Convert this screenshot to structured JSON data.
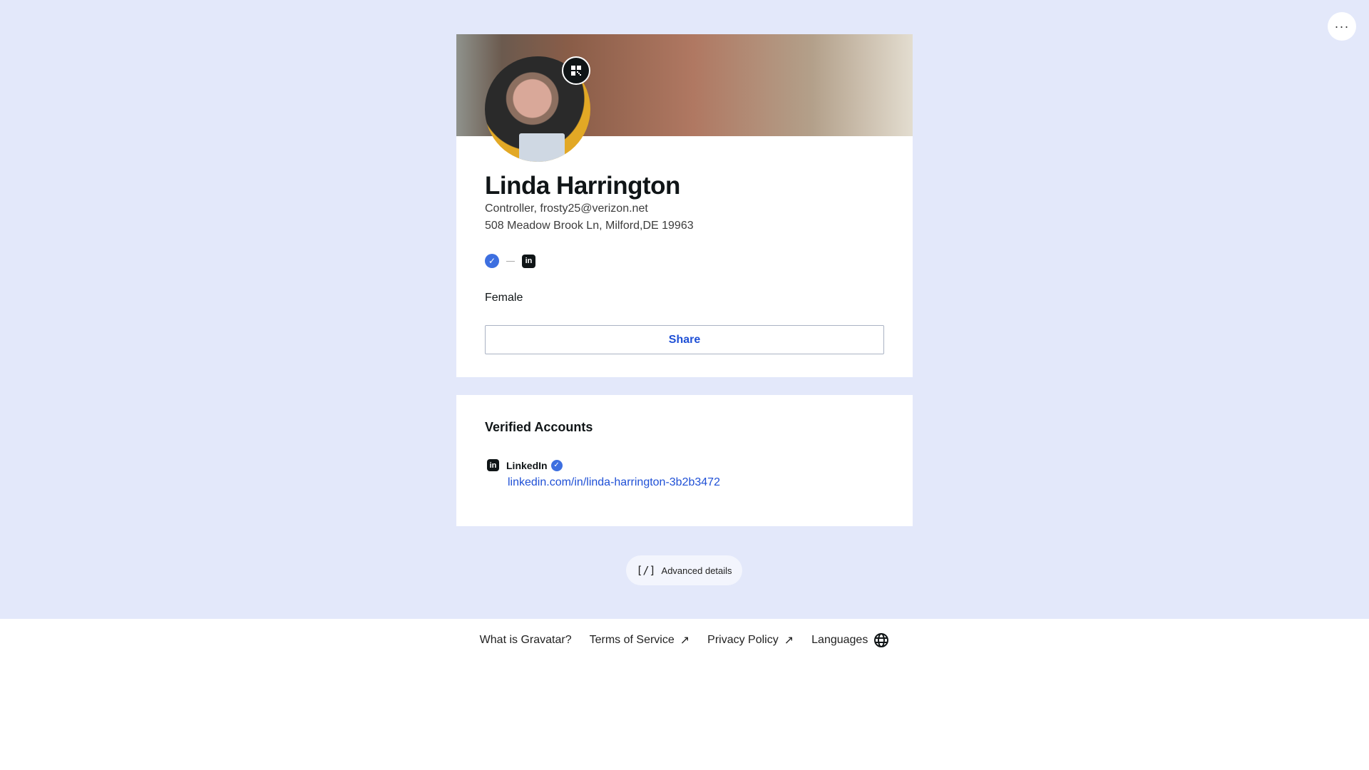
{
  "menu": {
    "more_label": "···"
  },
  "profile": {
    "name": "Linda Harrington",
    "subtitle": "Controller, frosty25@verizon.net",
    "address": "508 Meadow Brook Ln, Milford,DE 19963",
    "gender": "Female",
    "share_label": "Share",
    "verified_icon": "verified-badge-icon",
    "linkedin_icon": "linkedin-icon"
  },
  "verified": {
    "title": "Verified Accounts",
    "accounts": [
      {
        "service": "LinkedIn",
        "url": "linkedin.com/in/linda-harrington-3b2b3472"
      }
    ]
  },
  "advanced": {
    "icon": "[/]",
    "label": "Advanced details"
  },
  "footer": {
    "links": [
      "What is Gravatar?",
      "Terms of Service",
      "Privacy Policy",
      "Languages"
    ]
  },
  "colors": {
    "accent": "#1f50d6",
    "background": "#e3e8fa",
    "badge": "#3d6fe0"
  }
}
